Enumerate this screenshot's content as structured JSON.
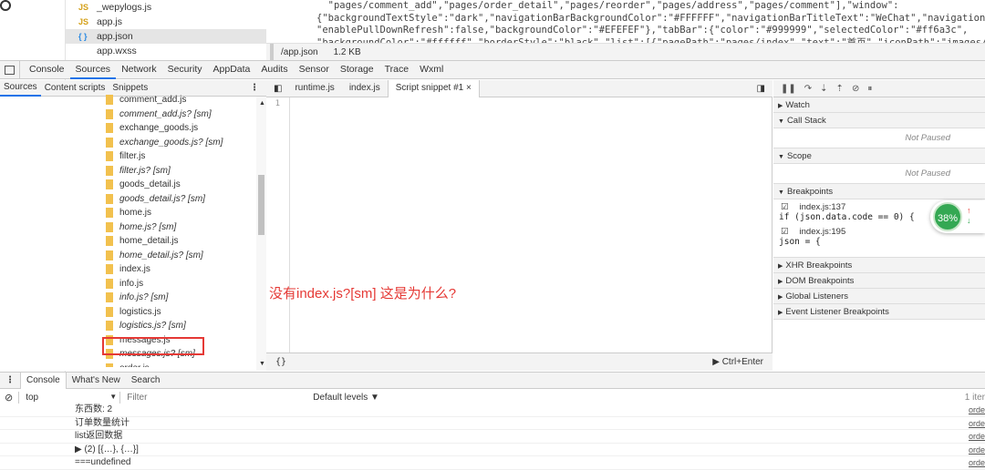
{
  "editor_top": {
    "files": [
      {
        "icon": "JS",
        "name": "_wepylogs.js",
        "selected": false
      },
      {
        "icon": "JS",
        "name": "app.js",
        "selected": false
      },
      {
        "icon": "{ }",
        "name": "app.json",
        "selected": true
      },
      {
        "icon": "",
        "name": "app.wxss",
        "selected": false
      }
    ],
    "code_lines": [
      "  \"pages/comment_add\",\"pages/order_detail\",\"pages/reorder\",\"pages/address\",\"pages/comment\"],\"window\":",
      "{\"backgroundTextStyle\":\"dark\",\"navigationBarBackgroundColor\":\"#FFFFFF\",\"navigationBarTitleText\":\"WeChat\",\"navigationBarTex",
      "\"enablePullDownRefresh\":false,\"backgroundColor\":\"#EFEFEF\"},\"tabBar\":{\"color\":\"#999999\",\"selectedColor\":\"#ff6a3c\",",
      "\"backgroundColor\":\"#ffffff\",\"borderStyle\":\"black\",\"list\":[{\"pagePath\":\"pages/index\",\"text\":\"首页\",\"iconPath\":\"images/icon_h"
    ],
    "file_path": "/app.json",
    "file_size": "1.2 KB"
  },
  "devtools": {
    "tabs": [
      "Console",
      "Sources",
      "Network",
      "Security",
      "AppData",
      "Audits",
      "Sensor",
      "Storage",
      "Trace",
      "Wxml"
    ],
    "active_tab": "Sources",
    "navigator": {
      "tabs": [
        "Sources",
        "Content scripts",
        "Snippets"
      ],
      "files": [
        {
          "name": "comment_add.js",
          "sm": false
        },
        {
          "name": "comment_add.js? [sm]",
          "sm": true
        },
        {
          "name": "exchange_goods.js",
          "sm": false
        },
        {
          "name": "exchange_goods.js? [sm]",
          "sm": true
        },
        {
          "name": "filter.js",
          "sm": false
        },
        {
          "name": "filter.js? [sm]",
          "sm": true
        },
        {
          "name": "goods_detail.js",
          "sm": false
        },
        {
          "name": "goods_detail.js? [sm]",
          "sm": true
        },
        {
          "name": "home.js",
          "sm": false
        },
        {
          "name": "home.js? [sm]",
          "sm": true
        },
        {
          "name": "home_detail.js",
          "sm": false
        },
        {
          "name": "home_detail.js? [sm]",
          "sm": true
        },
        {
          "name": "index.js",
          "sm": false
        },
        {
          "name": "info.js",
          "sm": false
        },
        {
          "name": "info.js? [sm]",
          "sm": true
        },
        {
          "name": "logistics.js",
          "sm": false
        },
        {
          "name": "logistics.js? [sm]",
          "sm": true
        },
        {
          "name": "messages.js",
          "sm": false
        },
        {
          "name": "messages.js? [sm]",
          "sm": true
        },
        {
          "name": "order.js",
          "sm": false
        }
      ]
    },
    "editor": {
      "tabs": [
        "runtime.js",
        "index.js",
        "Script snippet #1 ×"
      ],
      "active_tab_index": 2,
      "line_number": "1",
      "bottom_left": "{}",
      "run_hint": "▶ Ctrl+Enter"
    },
    "annotation": "没有index.js?[sm] 这是为什么?",
    "debugger": {
      "sections": {
        "watch": "Watch",
        "call_stack": "Call Stack",
        "not_paused": "Not Paused",
        "scope": "Scope",
        "breakpoints": "Breakpoints",
        "xhr": "XHR Breakpoints",
        "dom": "DOM Breakpoints",
        "global": "Global Listeners",
        "event": "Event Listener Breakpoints"
      },
      "breakpoints": [
        {
          "location": "index.js:137",
          "code": "if (json.data.code == 0) {"
        },
        {
          "location": "index.js:195",
          "code": "json = {"
        }
      ],
      "progress_label": "38%",
      "progress_value": 38
    },
    "drawer": {
      "tabs": [
        "Console",
        "What's New",
        "Search"
      ],
      "context": "top",
      "filter_placeholder": "Filter",
      "levels": "Default levels ▼",
      "count": "1 iter",
      "messages": [
        {
          "text": "东西数: 2",
          "src": "orde"
        },
        {
          "text": "订单数量统计",
          "src": "orde"
        },
        {
          "text": "list返回数据",
          "src": "orde"
        },
        {
          "text": "▶ (2) [{…}, {…}]",
          "src": "orde"
        },
        {
          "text": "===undefined",
          "src": "orde"
        }
      ]
    }
  }
}
